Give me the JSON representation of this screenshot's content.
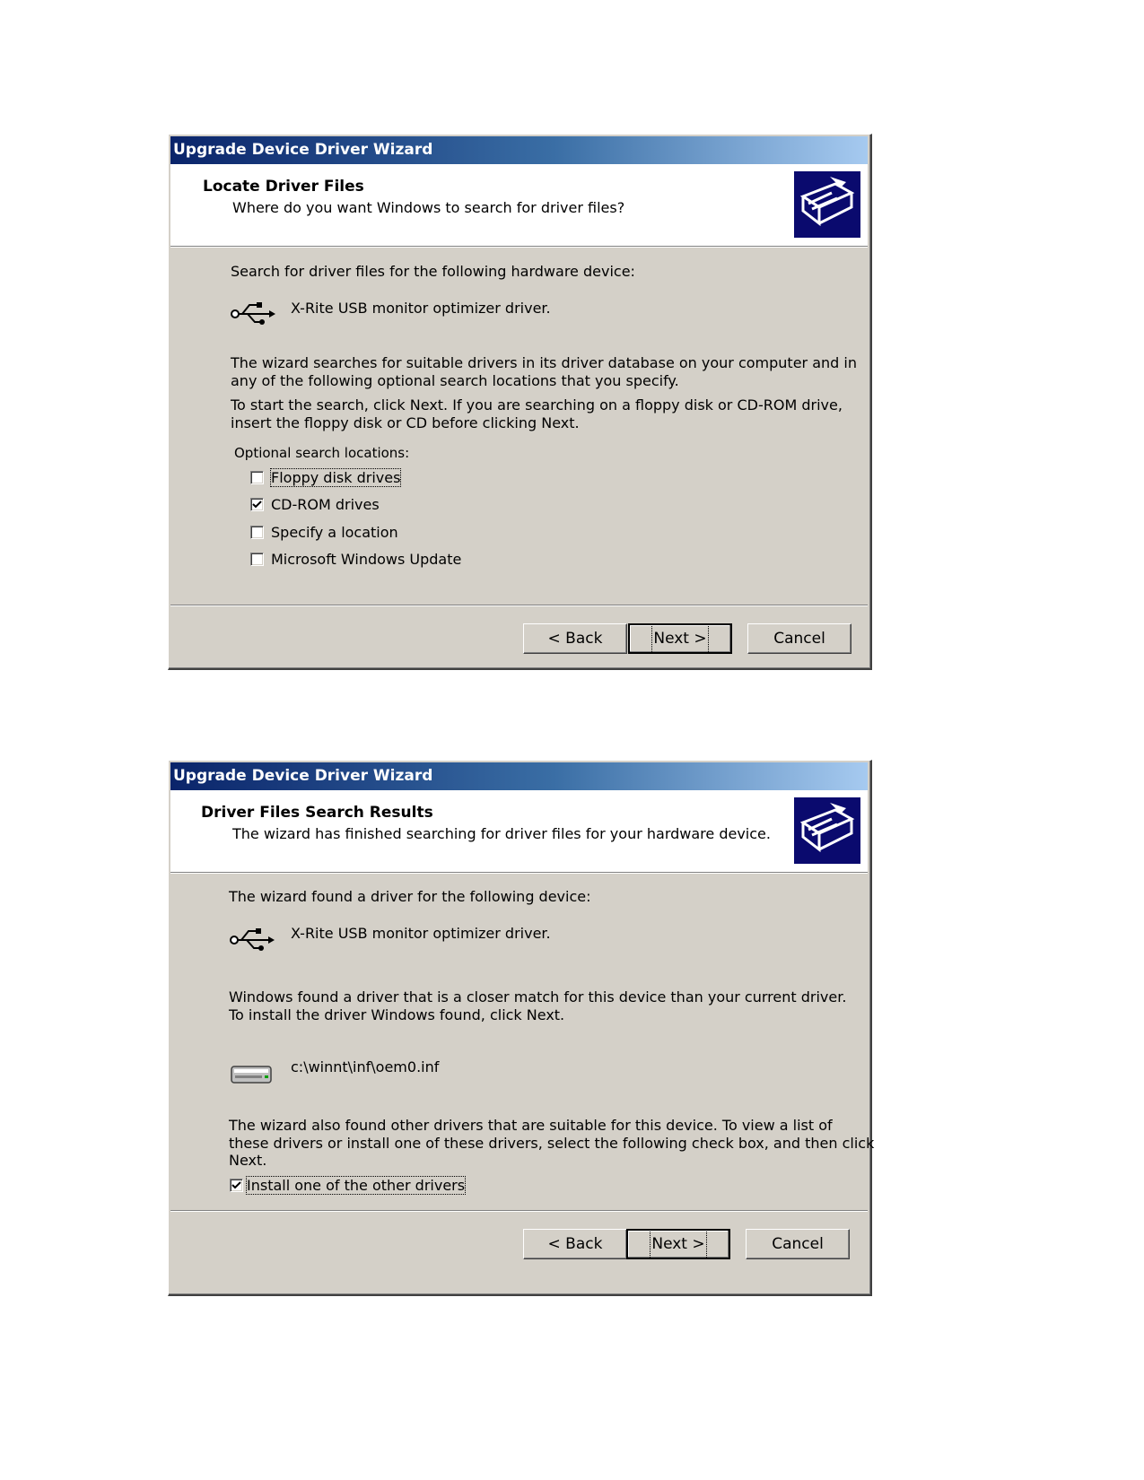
{
  "dialog1": {
    "title": "Upgrade Device Driver Wizard",
    "header_title": "Locate Driver Files",
    "header_subtitle": "Where do you want Windows to search for driver files?",
    "intro": "Search for driver files for the following hardware device:",
    "device_name": "X-Rite USB monitor optimizer driver.",
    "para1_line1": "The wizard searches for suitable drivers in its driver database on your computer and in",
    "para1_line2": "any of the following optional search locations that you specify.",
    "para2_line1": "To start the search, click Next. If you are searching on a floppy disk or CD-ROM drive,",
    "para2_line2": "insert the floppy disk or CD before clicking Next.",
    "optional_label": "Optional search locations:",
    "checkboxes": [
      {
        "label": "Floppy disk drives",
        "checked": false
      },
      {
        "label": "CD-ROM drives",
        "checked": true
      },
      {
        "label": "Specify a location",
        "checked": false
      },
      {
        "label": "Microsoft Windows Update",
        "checked": false
      }
    ],
    "buttons": {
      "back": "< Back",
      "next": "Next >",
      "cancel": "Cancel"
    }
  },
  "dialog2": {
    "title": "Upgrade Device Driver Wizard",
    "header_title": "Driver Files Search Results",
    "header_subtitle": "The wizard has finished searching for driver files for your hardware device.",
    "intro": "The wizard found a driver for the following device:",
    "device_name": "X-Rite USB monitor optimizer driver.",
    "para1_line1": "Windows found a driver that is a closer match for this device than your current driver.",
    "para1_line2": "To install the driver Windows found, click Next.",
    "driver_path": "c:\\winnt\\inf\\oem0.inf",
    "para2_line1": "The wizard also found other drivers that are suitable for this device. To view a list of",
    "para2_line2": "these drivers or install one of these drivers, select the following check box, and then click",
    "para2_line3": "Next.",
    "checkbox": {
      "label": "Install one of the other drivers",
      "checked": true
    },
    "buttons": {
      "back": "< Back",
      "next": "Next >",
      "cancel": "Cancel"
    }
  },
  "icons": [
    "wizard-hardware-icon",
    "usb-icon",
    "drive-icon",
    "checkmark-icon"
  ]
}
